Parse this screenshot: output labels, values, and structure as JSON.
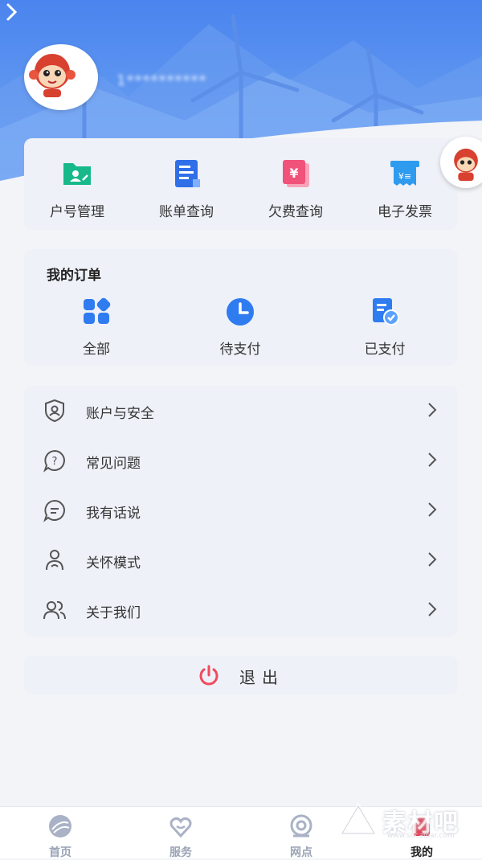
{
  "header": {
    "username": "1**********",
    "bg_top": "#4f8bef",
    "bg_bottom": "#6fa6f2"
  },
  "quick_actions": [
    {
      "label": "户号管理",
      "icon": "account-folder-icon",
      "color": "#17b88a"
    },
    {
      "label": "账单查询",
      "icon": "bill-document-icon",
      "color": "#2f6fe8"
    },
    {
      "label": "欠费查询",
      "icon": "arrears-yen-icon",
      "color": "#f0527a"
    },
    {
      "label": "电子发票",
      "icon": "invoice-icon",
      "color": "#2f9bef"
    }
  ],
  "orders": {
    "title": "我的订单",
    "items": [
      {
        "label": "全部",
        "icon": "all-grid-icon"
      },
      {
        "label": "待支付",
        "icon": "clock-icon"
      },
      {
        "label": "已支付",
        "icon": "paid-check-icon"
      }
    ]
  },
  "menu": [
    {
      "label": "账户与安全",
      "icon": "shield-user-icon"
    },
    {
      "label": "常见问题",
      "icon": "question-icon"
    },
    {
      "label": "我有话说",
      "icon": "chat-icon"
    },
    {
      "label": "关怀模式",
      "icon": "care-icon"
    },
    {
      "label": "关于我们",
      "icon": "users-icon"
    }
  ],
  "logout": {
    "label": "退出",
    "color": "#f04b5e"
  },
  "tabs": [
    {
      "label": "首页",
      "icon": "home-globe-icon"
    },
    {
      "label": "服务",
      "icon": "service-heart-icon"
    },
    {
      "label": "网点",
      "icon": "location-icon"
    },
    {
      "label": "我的",
      "icon": "profile-icon"
    }
  ],
  "watermark": {
    "text": "素材吧",
    "url": "www.sucaibar.com"
  }
}
